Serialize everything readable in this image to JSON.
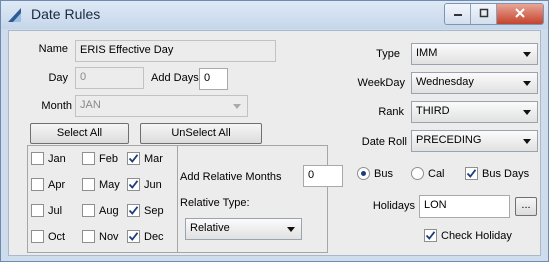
{
  "window": {
    "title": "Date Rules",
    "minimize_icon": "minimize-icon",
    "maximize_icon": "maximize-icon",
    "close_icon": "close-icon"
  },
  "form": {
    "name_label": "Name",
    "name_value": "ERIS Effective Day",
    "day_label": "Day",
    "day_value": "0",
    "add_days_label": "Add Days",
    "add_days_value": "0",
    "month_label": "Month",
    "month_value": "JAN",
    "select_all": "Select All",
    "unselect_all": "UnSelect All"
  },
  "months": [
    {
      "label": "Jan",
      "checked": false
    },
    {
      "label": "Feb",
      "checked": false
    },
    {
      "label": "Mar",
      "checked": true
    },
    {
      "label": "Apr",
      "checked": false
    },
    {
      "label": "May",
      "checked": false
    },
    {
      "label": "Jun",
      "checked": true
    },
    {
      "label": "Jul",
      "checked": false
    },
    {
      "label": "Aug",
      "checked": false
    },
    {
      "label": "Sep",
      "checked": true
    },
    {
      "label": "Oct",
      "checked": false
    },
    {
      "label": "Nov",
      "checked": false
    },
    {
      "label": "Dec",
      "checked": true
    }
  ],
  "relative": {
    "add_months_label": "Add Relative Months",
    "add_months_value": "0",
    "type_label": "Relative Type:",
    "type_value": "Relative"
  },
  "rules": {
    "type_label": "Type",
    "type_value": "IMM",
    "weekday_label": "WeekDay",
    "weekday_value": "Wednesday",
    "rank_label": "Rank",
    "rank_value": "THIRD",
    "date_roll_label": "Date Roll",
    "date_roll_value": "PRECEDING"
  },
  "calendar": {
    "bus_label": "Bus",
    "bus_selected": true,
    "cal_label": "Cal",
    "cal_selected": false,
    "bus_days_label": "Bus Days",
    "bus_days_checked": true,
    "holidays_label": "Holidays",
    "holidays_value": "LON",
    "browse_label": "...",
    "check_holiday_label": "Check Holiday",
    "check_holiday_checked": true
  }
}
